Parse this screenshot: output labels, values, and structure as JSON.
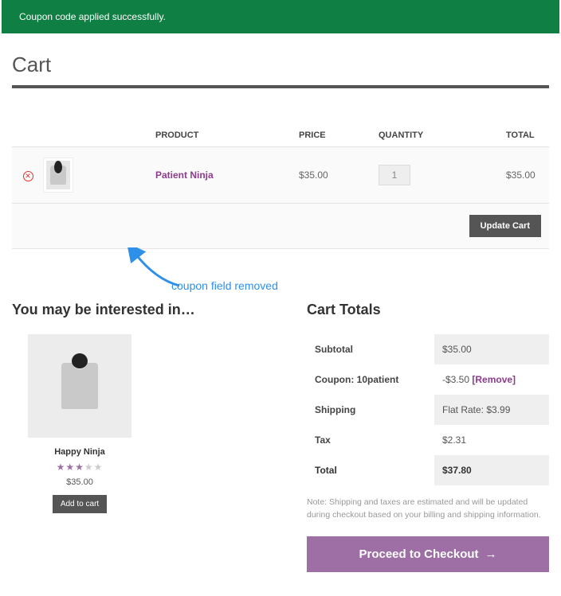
{
  "banner": {
    "text": "Coupon code applied successfully."
  },
  "page_title": "Cart",
  "cart": {
    "headers": {
      "product": "PRODUCT",
      "price": "PRICE",
      "qty": "QUANTITY",
      "total": "TOTAL"
    },
    "item": {
      "name": "Patient Ninja",
      "price": "$35.00",
      "qty": "1",
      "total": "$35.00"
    },
    "update_label": "Update Cart"
  },
  "annotation": "coupon field removed",
  "upsell": {
    "heading": "You may be interested in…",
    "product": {
      "name": "Happy Ninja",
      "rating": 3,
      "price": "$35.00",
      "button": "Add to cart"
    }
  },
  "totals": {
    "heading": "Cart Totals",
    "rows": {
      "subtotal_label": "Subtotal",
      "subtotal_value": "$35.00",
      "coupon_label": "Coupon: 10patient",
      "coupon_value": "-$3.50 ",
      "coupon_remove": "[Remove]",
      "shipping_label": "Shipping",
      "shipping_value": "Flat Rate: $3.99",
      "tax_label": "Tax",
      "tax_value": "$2.31",
      "total_label": "Total",
      "total_value": "$37.80"
    },
    "note": "Note: Shipping and taxes are estimated and will be updated during checkout based on your billing and shipping information.",
    "checkout": "Proceed to Checkout"
  }
}
